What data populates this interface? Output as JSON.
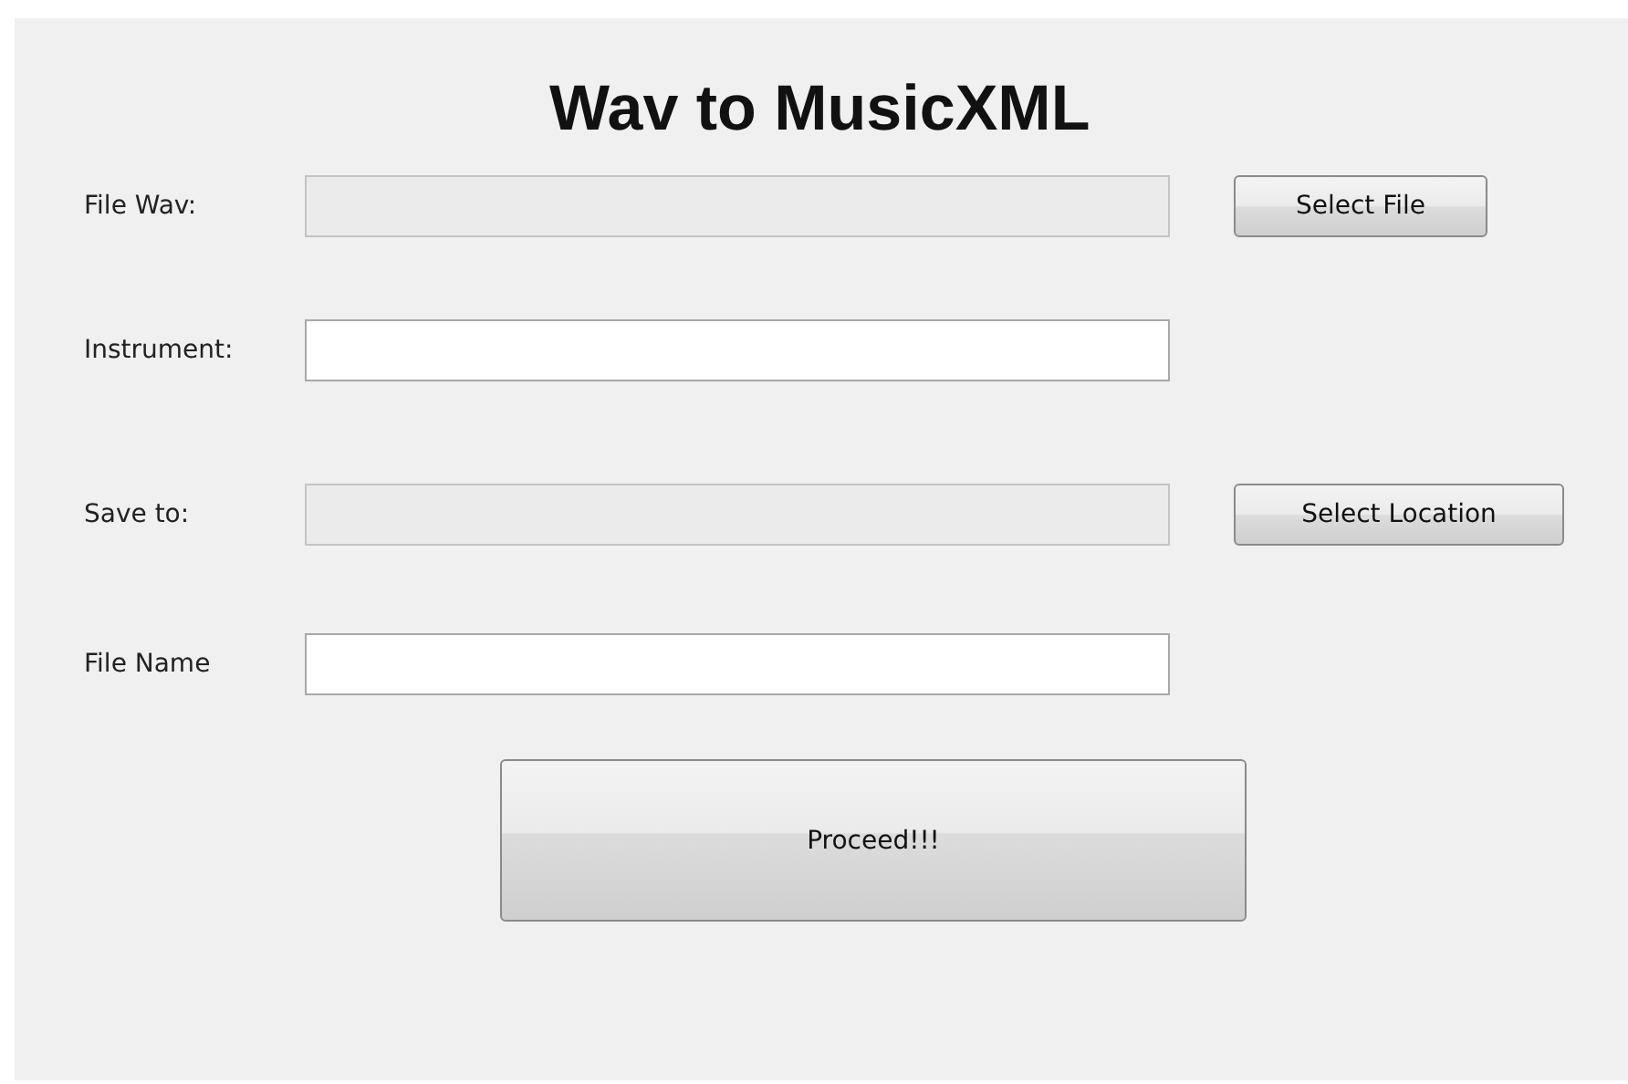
{
  "window": {
    "title": "Wav to MusicXML"
  },
  "rows": [
    {
      "label": "File Wav:",
      "disabled": true,
      "button": "Select File"
    },
    {
      "label": "Instrument:",
      "disabled": false
    },
    {
      "label": "Save to:",
      "disabled": true,
      "button": "Select Location"
    },
    {
      "label": "File Name",
      "disabled": false
    }
  ],
  "proceed_button": "Proceed!!!"
}
